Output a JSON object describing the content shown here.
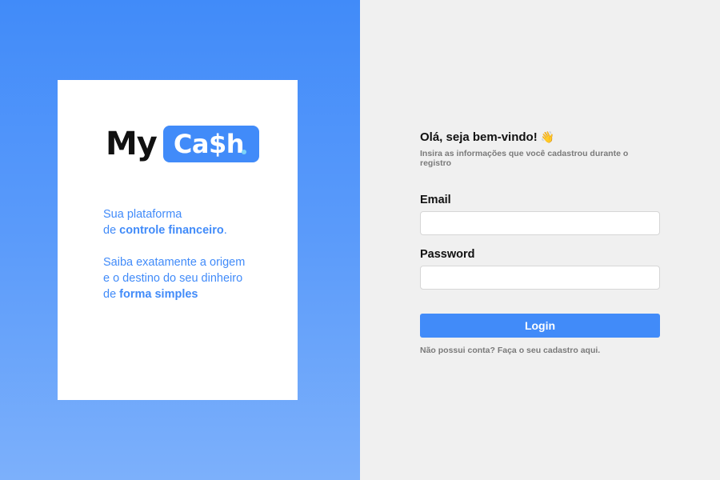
{
  "brand": {
    "logo_my": "My",
    "logo_cash": "Ca$h"
  },
  "tagline": {
    "p1_line1": "Sua plataforma",
    "p1_prefix": "de ",
    "p1_bold": "controle financeiro",
    "p1_suffix": ".",
    "p2_line1": "Saiba exatamente a origem",
    "p2_line2": "e o destino do seu dinheiro",
    "p2_prefix": "de ",
    "p2_bold": "forma simples"
  },
  "login": {
    "greeting": "Olá, seja bem-vindo!",
    "subtitle": "Insira as informações que você cadastrou durante o registro",
    "email_label": "Email",
    "email_value": "",
    "password_label": "Password",
    "password_value": "",
    "login_button": "Login",
    "signup_link": "Não possui conta? Faça o seu cadastro aqui."
  },
  "icons": {
    "wave": "waving-hand",
    "wave_glyph": "👋"
  },
  "colors": {
    "accent": "#418bf9",
    "accent_light": "#7cb0fb",
    "logo_dot": "#7dd3f8",
    "form_bg": "#f0f0f0"
  }
}
